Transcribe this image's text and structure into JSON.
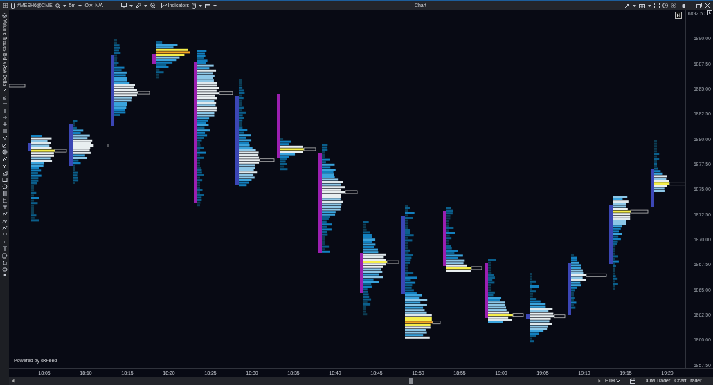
{
  "toolbar": {
    "symbol": "#MESH6@CME",
    "timeframe": "5m",
    "quantity": "Qty: N/A",
    "indicators": "Indicators"
  },
  "window": {
    "title": "Chart"
  },
  "side_panel": {
    "tabs": [
      "Volume",
      "Trades",
      "Bid x Ask",
      "Delta"
    ]
  },
  "chart": {
    "credit": "Powered by dxFeed",
    "price_ticks": [
      "6892.50",
      "6890.00",
      "6887.50",
      "6885.00",
      "6882.50",
      "6880.00",
      "6877.50",
      "6875.00",
      "6872.50",
      "6870.00",
      "6867.50",
      "6865.00",
      "6862.50",
      "6860.00",
      "6857.50"
    ],
    "time_ticks": [
      "18:05",
      "18:10",
      "18:15",
      "18:20",
      "18:25",
      "18:30",
      "18:35",
      "18:40",
      "18:45",
      "18:50",
      "18:55",
      "19:00",
      "19:05",
      "19:10",
      "19:15",
      "19:20"
    ]
  },
  "status_bar": {
    "session": "ETH",
    "buttons": [
      "DOM Trader",
      "Chart Trader"
    ]
  }
}
